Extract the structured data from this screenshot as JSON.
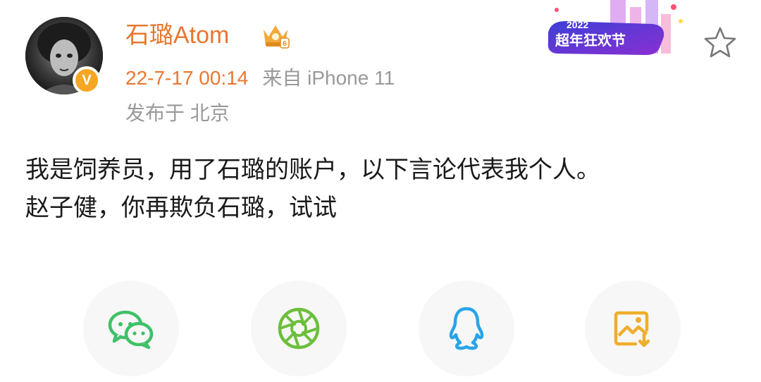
{
  "post": {
    "username": "石璐Atom",
    "verified_badge": "V",
    "vip_icon": "crown-vip-icon",
    "timestamp": "22-7-17 00:14",
    "source": "来自 iPhone 11",
    "location": "发布于 北京",
    "content_lines": [
      "我是饲养员，用了石璐的账户，以下言论代表我个人。",
      "赵子健，你再欺负石璐，试试"
    ]
  },
  "banner": {
    "year": "2022",
    "title": "超年狂欢节"
  },
  "actions": {
    "favorite_icon": "star-icon"
  },
  "share": [
    {
      "name": "wechat",
      "icon": "wechat-icon",
      "color": "#3fc168"
    },
    {
      "name": "moments",
      "icon": "moments-icon",
      "color": "#6dbf3b"
    },
    {
      "name": "qq",
      "icon": "qq-icon",
      "color": "#2aa4e8"
    },
    {
      "name": "save-image",
      "icon": "save-image-icon",
      "color": "#f0ae2c"
    }
  ],
  "colors": {
    "username": "#e8772e",
    "meta_gray": "#999999",
    "text": "#1a1a1a",
    "verified": "#f5a623"
  }
}
